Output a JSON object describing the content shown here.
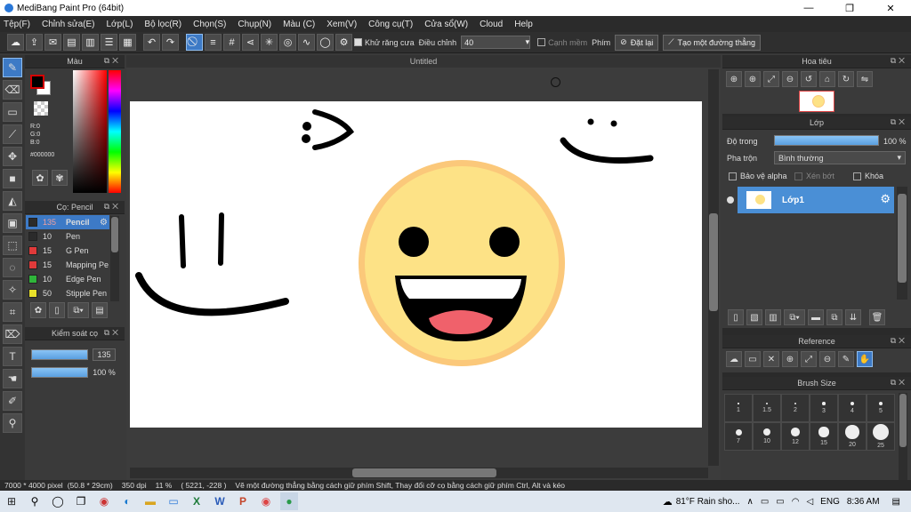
{
  "window": {
    "title": "MediBang Paint Pro (64bit)",
    "controls": [
      "—",
      "❐",
      "✕"
    ]
  },
  "menu": [
    "Tệp(F)",
    "Chỉnh sửa(E)",
    "Lớp(L)",
    "Bộ lọc(R)",
    "Chọn(S)",
    "Chụp(N)",
    "Màu (C)",
    "Xem(V)",
    "Công cụ(T)",
    "Cửa sổ(W)",
    "Cloud",
    "Help"
  ],
  "toolbar": {
    "antialias_label": "Khử răng cưa",
    "adjust_label": "Điều chỉnh",
    "adjust_value": "40",
    "soft_edge_label": "Cạnh mềm",
    "key_label": "Phím",
    "reset_label": "Đặt lại",
    "straight_line_label": "Tạo một đường thẳng"
  },
  "color_panel": {
    "title": "Màu",
    "r": "R:0",
    "g": "G:0",
    "b": "B:0",
    "hex": "#000000"
  },
  "brush_panel": {
    "title": "Cọ: Pencil",
    "items": [
      {
        "size": "135",
        "name": "Pencil",
        "color": "#2b2b2b"
      },
      {
        "size": "10",
        "name": "Pen",
        "color": "#2b2b2b"
      },
      {
        "size": "15",
        "name": "G Pen",
        "color": "#e03a3a"
      },
      {
        "size": "15",
        "name": "Mapping Pe",
        "color": "#e03a3a"
      },
      {
        "size": "10",
        "name": "Edge Pen",
        "color": "#2fb53a"
      },
      {
        "size": "50",
        "name": "Stipple Pen",
        "color": "#e8e02a"
      }
    ]
  },
  "control_panel": {
    "title": "Kiểm soát cọ",
    "size_value": "135",
    "opacity_value": "100 %"
  },
  "canvas": {
    "title": "Untitled"
  },
  "navigator": {
    "title": "Hoa tiêu"
  },
  "layer_panel": {
    "title": "Lớp",
    "opacity_label": "Độ trong",
    "opacity_value": "100 %",
    "blend_label": "Pha trộn",
    "blend_value": "Bình thường",
    "protect_alpha_label": "Bảo vệ alpha",
    "clip_label": "Xén bớt",
    "lock_label": "Khóa",
    "layer_name": "Lớp1"
  },
  "reference_panel": {
    "title": "Reference"
  },
  "brush_size_panel": {
    "title": "Brush Size",
    "sizes": [
      "1",
      "1.5",
      "2",
      "3",
      "4",
      "5",
      "7",
      "10",
      "12",
      "15",
      "20",
      "25"
    ]
  },
  "status": {
    "size": "7000 * 4000 pixel",
    "cm": "(50.8 * 29cm)",
    "dpi": "350 dpi",
    "zoom": "11 %",
    "coords": "( 5221, -228 )",
    "hint": "Vẽ một đường thẳng bằng cách giữ phím Shift, Thay đổi cỡ cọ bằng cách giữ phím Ctrl, Alt và kéo"
  },
  "taskbar": {
    "weather": "81°F  Rain sho...",
    "lang": "ENG",
    "time": "8:36 AM"
  }
}
